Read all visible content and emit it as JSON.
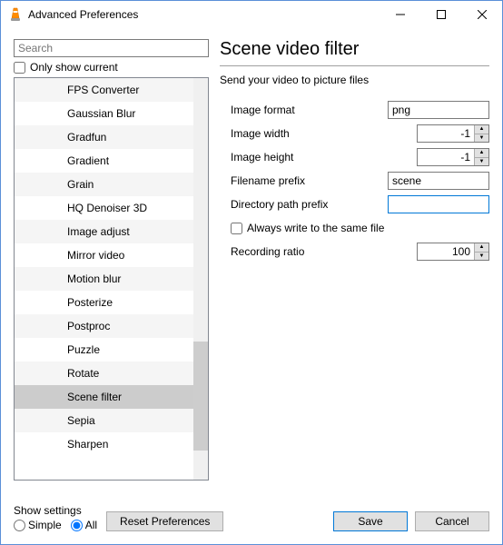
{
  "window": {
    "title": "Advanced Preferences"
  },
  "left": {
    "searchPlaceholder": "Search",
    "onlyShowCurrent": "Only show current",
    "items": [
      "FPS Converter",
      "Gaussian Blur",
      "Gradfun",
      "Gradient",
      "Grain",
      "HQ Denoiser 3D",
      "Image adjust",
      "Mirror video",
      "Motion blur",
      "Posterize",
      "Postproc",
      "Puzzle",
      "Rotate",
      "Scene filter",
      "Sepia",
      "Sharpen"
    ],
    "selectedIndex": 13
  },
  "right": {
    "heading": "Scene video filter",
    "subtitle": "Send your video to picture files",
    "labels": {
      "imageFormat": "Image format",
      "imageWidth": "Image width",
      "imageHeight": "Image height",
      "filenamePrefix": "Filename prefix",
      "dirPrefix": "Directory path prefix",
      "alwaysWrite": "Always write to the same file",
      "recordingRatio": "Recording ratio"
    },
    "values": {
      "imageFormat": "png",
      "imageWidth": "-1",
      "imageHeight": "-1",
      "filenamePrefix": "scene",
      "dirPrefix": "",
      "recordingRatio": "100"
    }
  },
  "footer": {
    "showSettings": "Show settings",
    "simple": "Simple",
    "all": "All",
    "reset": "Reset Preferences",
    "save": "Save",
    "cancel": "Cancel"
  }
}
